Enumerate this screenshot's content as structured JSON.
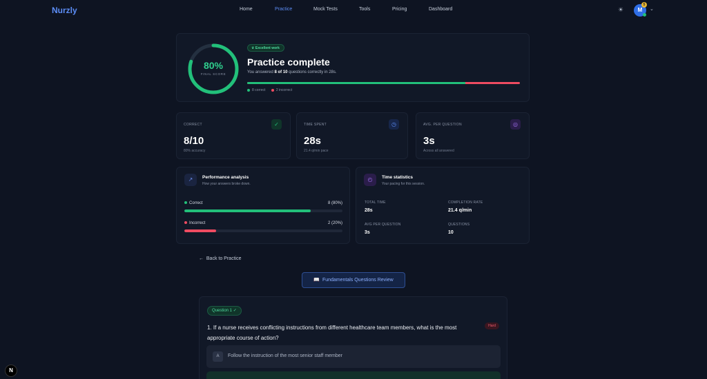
{
  "nav": {
    "logo": "Nurzly",
    "items": [
      {
        "label": "Home",
        "active": false
      },
      {
        "label": "Practice",
        "active": true
      },
      {
        "label": "Mock Tests",
        "active": false
      },
      {
        "label": "Tools",
        "active": false
      },
      {
        "label": "Pricing",
        "active": false
      },
      {
        "label": "Dashboard",
        "active": false
      }
    ],
    "avatar_initial": "M",
    "avatar_badge": "5"
  },
  "hero": {
    "score": "80%",
    "score_label": "FINAL SCORE",
    "score_fraction": 0.8,
    "badge": "Excellent work",
    "title": "Practice complete",
    "sub_prefix": "You answered ",
    "sub_bold": "8 of 10",
    "sub_suffix": " questions correctly in 28s.",
    "correct_fraction": 0.8,
    "legend_correct": "8 correct",
    "legend_incorrect": "2 incorrect"
  },
  "stats": [
    {
      "label": "CORRECT",
      "value": "8/10",
      "sub": "80% accuracy",
      "icon": "check-circle-icon",
      "color": "#22c07a"
    },
    {
      "label": "TIME SPENT",
      "value": "28s",
      "sub": "21.4 q/min pace",
      "icon": "clock-icon",
      "color": "#5c8df6"
    },
    {
      "label": "AVG. PER QUESTION",
      "value": "3s",
      "sub": "Across all answered",
      "icon": "target-icon",
      "color": "#a070f0"
    }
  ],
  "performance": {
    "title": "Performance analysis",
    "desc": "How your answers broke down.",
    "rows": [
      {
        "name": "Correct",
        "pct": "8 (80%)",
        "fraction": 0.8,
        "color": "#22c07a"
      },
      {
        "name": "Incorrect",
        "pct": "2 (20%)",
        "fraction": 0.2,
        "color": "#ef4b61"
      }
    ]
  },
  "time_stats": {
    "title": "Time statistics",
    "desc": "Your pacing for this session.",
    "items": [
      {
        "label": "TOTAL TIME",
        "value": "28s"
      },
      {
        "label": "COMPLETION RATE",
        "value": "21.4 q/min"
      },
      {
        "label": "AVG PER QUESTION",
        "value": "3s"
      },
      {
        "label": "QUESTIONS",
        "value": "10"
      }
    ]
  },
  "back_label": "Back to Practice",
  "review_label": "Fundamentals Questions Review",
  "question": {
    "badge": "Question 1",
    "text": "1. If a nurse receives conflicting instructions from different healthcare team members, what is the most appropriate course of action?",
    "difficulty": "Hard",
    "options": [
      {
        "letter": "A",
        "text": "Follow the instruction of the most senior staff member"
      }
    ]
  }
}
